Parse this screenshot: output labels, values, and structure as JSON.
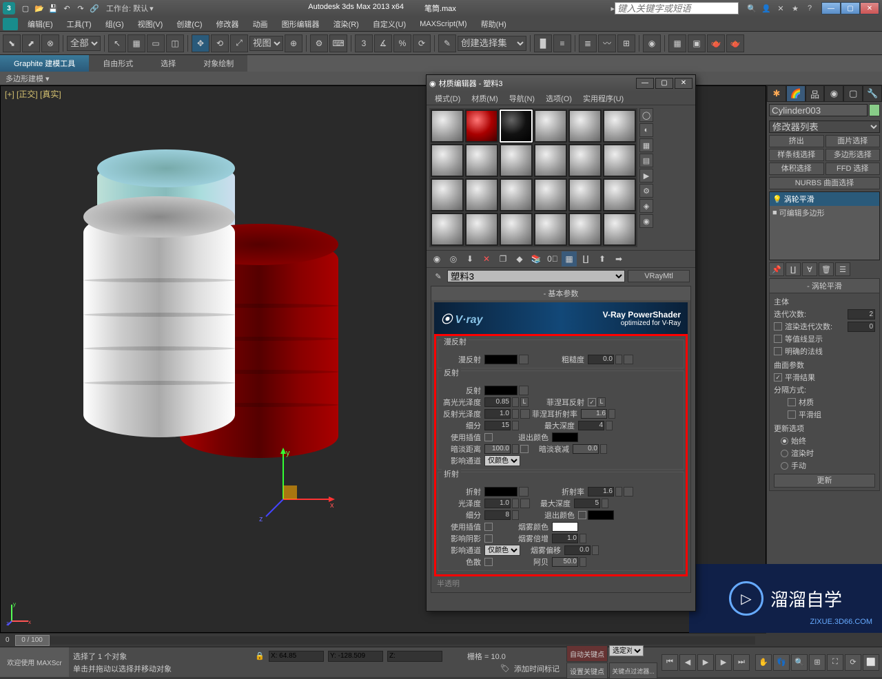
{
  "title": {
    "app": "Autodesk 3ds Max  2013 x64",
    "file": "笔筒.max",
    "workspace_label": "工作台: 默认",
    "search_placeholder": "键入关键字或短语"
  },
  "menubar": [
    "编辑(E)",
    "工具(T)",
    "组(G)",
    "视图(V)",
    "创建(C)",
    "修改器",
    "动画",
    "图形编辑器",
    "渲染(R)",
    "自定义(U)",
    "MAXScript(M)",
    "帮助(H)"
  ],
  "toolbar": {
    "filter": "全部",
    "view_mode": "视图",
    "create_set": "创建选择集"
  },
  "graphite": {
    "tabs": [
      "Graphite 建模工具",
      "自由形式",
      "选择",
      "对象绘制"
    ],
    "poly": "多边形建模"
  },
  "viewport": {
    "label": "[+] [正交] [真实]",
    "frame_current": "0",
    "frame_range": "0 / 100"
  },
  "cmd_panel": {
    "object_name": "Cylinder003",
    "modlist_label": "修改器列表",
    "mod_buttons": [
      "挤出",
      "面片选择",
      "样条线选择",
      "多边形选择",
      "体积选择",
      "FFD 选择",
      "NURBS 曲面选择"
    ],
    "stack": [
      {
        "icon": "💡",
        "label": "涡轮平滑",
        "sel": true
      },
      {
        "icon": "■",
        "label": "可编辑多边形",
        "sel": false
      }
    ],
    "turbo": {
      "header": "涡轮平滑",
      "main_grp": "主体",
      "iterations": "迭代次数:",
      "iter_val": "2",
      "render_iter": "渲染迭代次数:",
      "render_iter_val": "0",
      "isoline": "等值线显示",
      "explicit": "明确的法线",
      "surface_grp": "曲面参数",
      "smooth_result": "平滑结果",
      "sep_by": "分隔方式:",
      "by_mat": "材质",
      "by_smg": "平滑组",
      "update_grp": "更新选项",
      "upd_always": "始终",
      "upd_render": "渲染时",
      "upd_manual": "手动",
      "upd_btn": "更新"
    }
  },
  "mat_editor": {
    "title": "材质编辑器 - 塑料3",
    "menu": [
      "模式(D)",
      "材质(M)",
      "导航(N)",
      "选项(O)",
      "实用程序(U)"
    ],
    "mat_name": "塑料3",
    "mat_type": "VRayMtl",
    "basic_hdr": "基本参数",
    "vray": {
      "brand": "V·ray",
      "t1": "V-Ray PowerShader",
      "t2": "optimized for V-Ray"
    },
    "diffuse": {
      "grp": "漫反射",
      "diffuse": "漫反射",
      "roughness": "粗糙度",
      "roughness_val": "0.0"
    },
    "reflect": {
      "grp": "反射",
      "reflect": "反射",
      "hglossy": "高光光泽度",
      "hglossy_val": "0.85",
      "rglossy": "反射光泽度",
      "rglossy_val": "1.0",
      "subdivs": "细分",
      "subdivs_val": "15",
      "useinterp": "使用插值",
      "dimdist": "暗淡距离",
      "dimdist_val": "100.0",
      "affect": "影响通道",
      "affect_val": "仅颜色",
      "fresnel": "菲涅耳反射",
      "fior": "菲涅耳折射率",
      "fior_val": "1.6",
      "maxdepth": "最大深度",
      "maxdepth_val": "4",
      "exitcolor": "退出颜色",
      "dimfall": "暗淡衰减",
      "dimfall_val": "0.0"
    },
    "refract": {
      "grp": "折射",
      "refract": "折射",
      "glossy": "光泽度",
      "glossy_val": "1.0",
      "subdivs": "细分",
      "subdivs_val": "8",
      "useinterp": "使用插值",
      "affectshadow": "影响阴影",
      "affect": "影响通道",
      "affect_val": "仅颜色",
      "dispersion": "色散",
      "ior": "折射率",
      "ior_val": "1.6",
      "maxdepth": "最大深度",
      "maxdepth_val": "5",
      "exitcolor": "退出颜色",
      "fogcolor": "烟雾颜色",
      "fogmult": "烟雾倍增",
      "fogmult_val": "1.0",
      "fogbias": "烟雾偏移",
      "fogbias_val": "0.0",
      "abbe": "阿贝",
      "abbe_val": "50.0"
    },
    "translucency": "半透明"
  },
  "status": {
    "welcome": "欢迎使用  MAXScr",
    "sel": "选择了 1 个对象",
    "hint": "单击并拖动以选择并移动对象",
    "x": "X: 64.85",
    "y": "Y: -128.509",
    "z": "Z:",
    "grid": "栅格 = 10.0",
    "addtime": "添加时间标记",
    "autokey": "自动关键点",
    "selset": "选定对",
    "setkey": "设置关键点",
    "keyfilter": "关键点过滤器..."
  },
  "watermark": {
    "txt": "溜溜自学",
    "sub": "ZIXUE.3D66.COM"
  }
}
